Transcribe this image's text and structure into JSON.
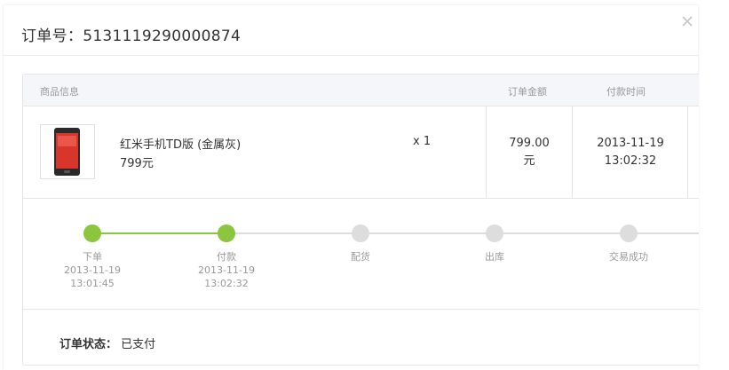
{
  "dialog": {
    "title": "订单号：5131119290000874"
  },
  "table": {
    "headers": {
      "product": "商品信息",
      "amount": "订单金额",
      "pay_time": "付款时间"
    },
    "item": {
      "name": "红米手机TD版 (金属灰)",
      "price": "799元",
      "quantity": "x 1",
      "amount_value": "799.00",
      "amount_unit": "元",
      "pay_date": "2013-11-19",
      "pay_clock": "13:02:32"
    }
  },
  "progress": {
    "steps": [
      {
        "label": "下单",
        "date": "2013-11-19",
        "time": "13:01:45",
        "done": true
      },
      {
        "label": "付款",
        "date": "2013-11-19",
        "time": "13:02:32",
        "done": true
      },
      {
        "label": "配货",
        "date": "",
        "time": "",
        "done": false
      },
      {
        "label": "出库",
        "date": "",
        "time": "",
        "done": false
      },
      {
        "label": "交易成功",
        "date": "",
        "time": "",
        "done": false
      }
    ]
  },
  "status": {
    "label": "订单状态：",
    "value": "已支付"
  },
  "colors": {
    "step_done": "#8cc63f",
    "step_pending": "#dddddd",
    "header_bg": "#f5f6fa"
  }
}
